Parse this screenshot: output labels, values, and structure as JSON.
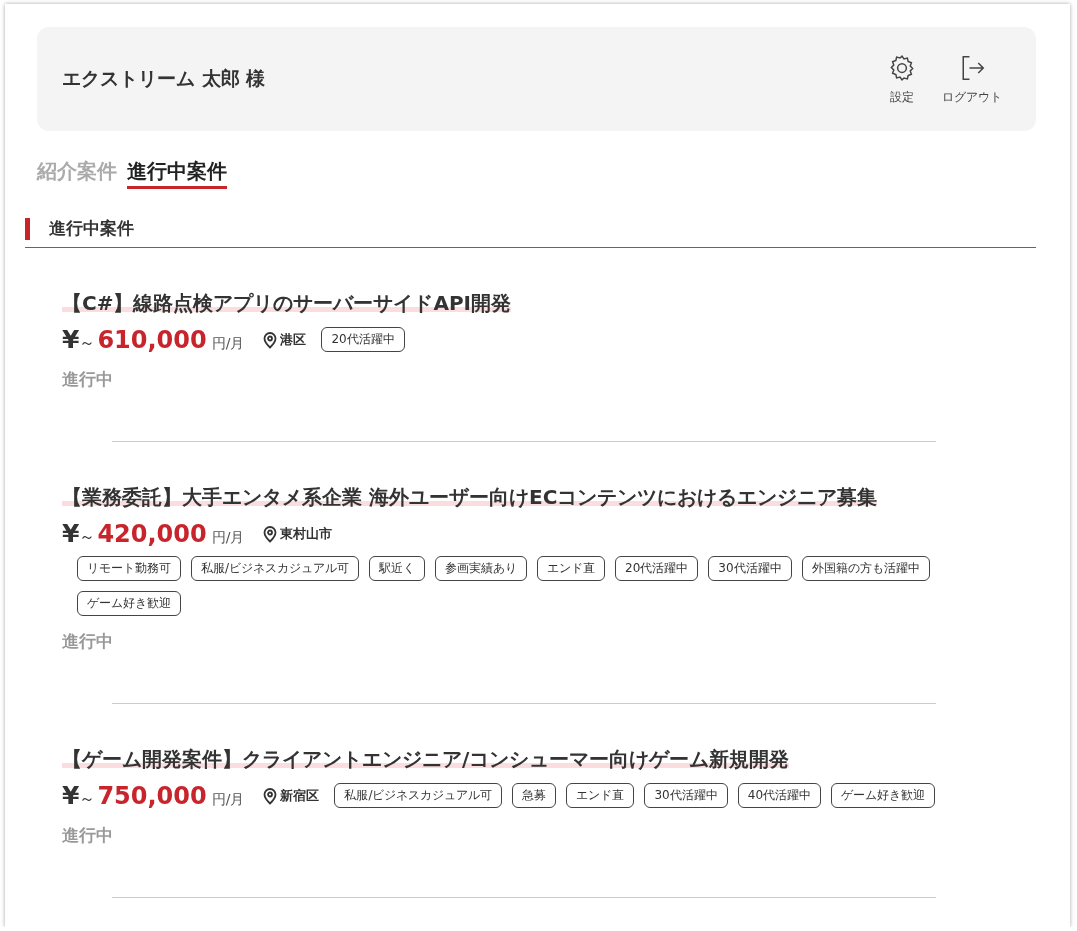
{
  "header": {
    "user_name": "エクストリーム 太郎 様",
    "actions": [
      {
        "kind": "settings",
        "label": "設定"
      },
      {
        "kind": "logout",
        "label": "ログアウト"
      }
    ]
  },
  "tabs": [
    {
      "label": "紹介案件",
      "selected": false
    },
    {
      "label": "進行中案件",
      "selected": true
    }
  ],
  "section_title": "進行中案件",
  "jobs": [
    {
      "title": "【C#】線路点検アプリのサーバーサイドAPI開発",
      "currency": "¥",
      "tilde": "～",
      "salary": "610,000",
      "unit": "円/月",
      "location": "港区",
      "tags": [
        "20代活躍中"
      ],
      "status": "進行中"
    },
    {
      "title": "【業務委託】大手エンタメ系企業 海外ユーザー向けECコンテンツにおけるエンジニア募集",
      "currency": "¥",
      "tilde": "～",
      "salary": "420,000",
      "unit": "円/月",
      "location": "東村山市",
      "tags": [
        "リモート勤務可",
        "私服/ビジネスカジュアル可",
        "駅近く",
        "参画実績あり",
        "エンド直",
        "20代活躍中",
        "30代活躍中",
        "外国籍の方も活躍中",
        "ゲーム好き歓迎"
      ],
      "status": "進行中"
    },
    {
      "title": "【ゲーム開発案件】クライアントエンジニア/コンシューマー向けゲーム新規開発",
      "currency": "¥",
      "tilde": "～",
      "salary": "750,000",
      "unit": "円/月",
      "location": "新宿区",
      "tags": [
        "私服/ビジネスカジュアル可",
        "急募",
        "エンド直",
        "30代活躍中",
        "40代活躍中",
        "ゲーム好き歓迎"
      ],
      "status": "進行中"
    }
  ]
}
